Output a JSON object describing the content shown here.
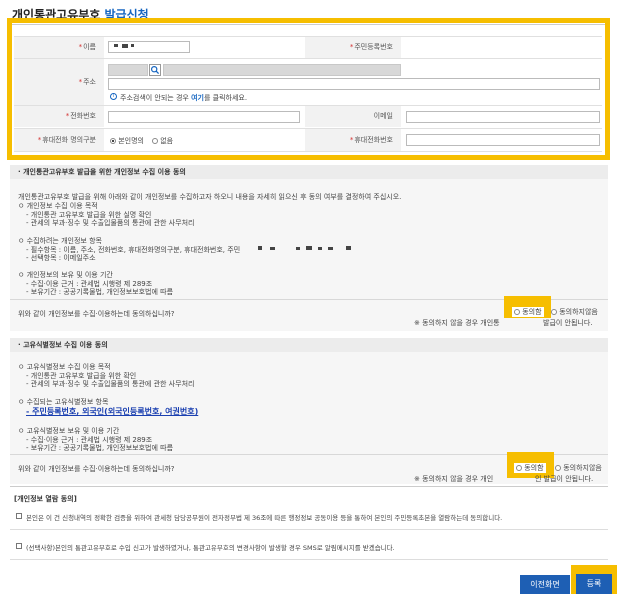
{
  "header": {
    "title_prefix": "개인통관고유부호",
    "title_highlight": "발급신청"
  },
  "form": {
    "name_label": "이름",
    "rrn_label": "주민등록번호",
    "address_label": "주소",
    "address_hint_prefix": "주소검색이 안되는 경우",
    "address_hint_link": "여기",
    "address_hint_suffix": "를 클릭하세요.",
    "phone_label": "전화번호",
    "email_label": "이메일",
    "owner_label": "휴대전화 명의구분",
    "owner_options": [
      "본인명의",
      "없음"
    ],
    "mobile_label": "휴대전화번호"
  },
  "privacy": {
    "title": "· 개인통관고유부호 발급을 위한 개인정보 수집 이용 동의",
    "intro": "개인통관고유부호 발급을 위해 아래와 같이 개인정보를 수집하고자 하오니 내용을 자세히 읽으신 후 동의 여부를 결정하여 주십시오.",
    "purpose_head": "ㅇ 개인정보 수집 이용 목적",
    "purpose_1": "- 개인통관 고유부호 발급을 위한 실명 확인",
    "purpose_2": "- 관세의 부과·징수 및 수출입물품의 통관에 관한 사무처리",
    "items_head": "ㅇ 수집하려는 개인정보 항목",
    "items_1": "- 필수항목 : 이름, 주소, 전화번호, 휴대전화명의구분, 휴대전화번호, 주민",
    "items_2": "- 선택항목 : 이메일주소",
    "retention_head": "ㅇ 개인정보의 보유 및 이용 기간",
    "retention_1": "- 수집·이용 근거 : 관세법 시행령 제 289조",
    "retention_2": "- 보유기간 : 공공기록물법, 개인정보보호법에 따름",
    "question": "위와 같이 개인정보를 수집·이용하는데 동의하십니까?",
    "agree": "동의함",
    "disagree": "동의하지않음",
    "note_left": "※ 동의하지 않을 경우 개인통",
    "note_right": "발급이 안됩니다."
  },
  "unique": {
    "title": "· 고유식별정보 수집 이용 동의",
    "purpose_head": "ㅇ 고유식별정보 수집 이용 목적",
    "purpose_1": "- 개인통관 고유부호 발급을 위한 확인",
    "purpose_2": "- 관세의 부과·징수 및 수출입물품의 통관에 관한 사무처리",
    "items_head": "ㅇ 수집되는 고유식별정보 항목",
    "items_1": "- 주민등록번호, 외국인(외국인등록번호, 여권번호)",
    "retention_head": "ㅇ 고유식별정보 보유 및 이용 기간",
    "retention_1": "- 수집·이용 근거 : 관세법 시행령 제 289조",
    "retention_2": "- 보유기간 : 공공기록물법, 개인정보보호법에 따름",
    "question": "위와 같이 개인정보를 수집·이용하는데 동의하십니까?",
    "agree": "동의함",
    "disagree": "동의하지않음",
    "note_left": "※ 동의하지 않을 경우 개인",
    "note_right": "인 발급이 안됩니다."
  },
  "view": {
    "title": "[개인정보 열람 동의]",
    "text": "본인은 이 건 신청내역의 정확한 검증을 위하여 관세청 담당공무원이 전자정부법 제 36조에 따른 행정정보 공동이용 등을 통하여 본인의 주민등록초본을 열람하는데 동의합니다.",
    "sms": "(선택사항)본인의 통관고유부호로 수입 신고가 발생하였거나, 통관고유부호의 변경사항이 발생할 경우 SMS로 알림메시지를 받겠습니다."
  },
  "buttons": {
    "prev": "이전화면",
    "submit": "등록"
  },
  "colors": {
    "highlight": "#f6be00",
    "accent": "#1565c0",
    "required": "#d32f2f"
  }
}
